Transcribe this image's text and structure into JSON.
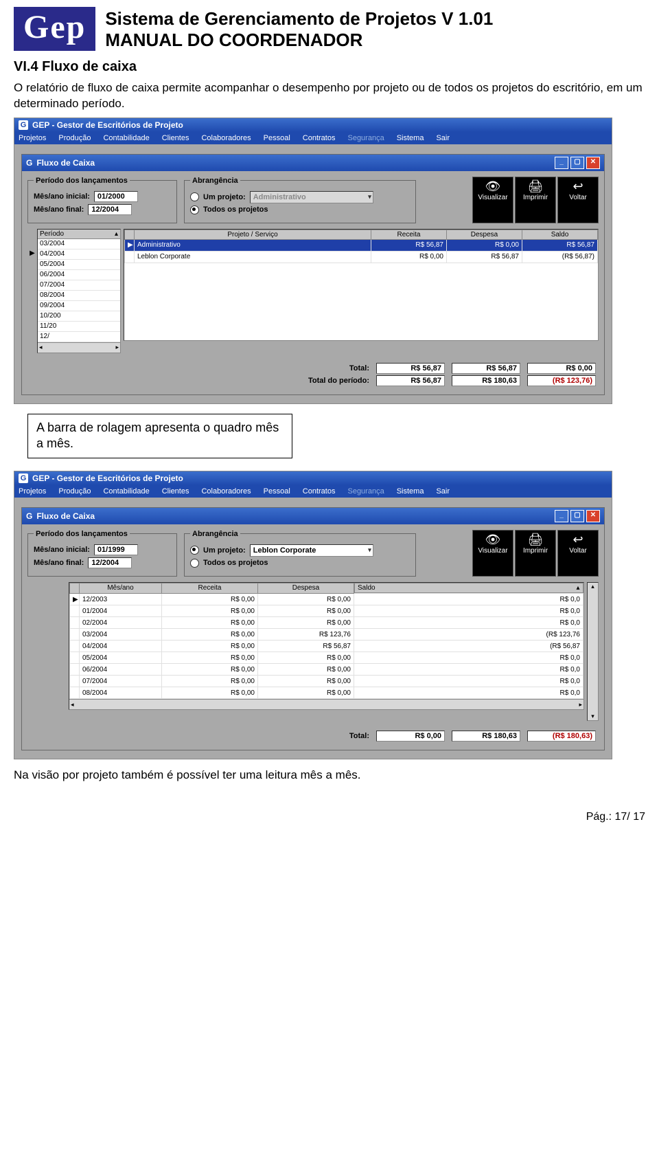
{
  "doc": {
    "logo_text": "Gep",
    "title": "Sistema de Gerenciamento de Projetos V 1.01",
    "subtitle": "MANUAL DO COORDENADOR",
    "section_heading": "VI.4  Fluxo de caixa",
    "paragraph": "O  relatório  de fluxo de caixa permite acompanhar o desempenho por projeto ou de todos os projetos do escritório, em um determinado período.",
    "callout": "A barra de rolagem apresenta o quadro mês a mês.",
    "closing_line": "Na visão por projeto também é possível ter uma leitura mês a mês.",
    "page_footer": "Pág.: 17/ 17"
  },
  "common": {
    "app_title": "GEP - Gestor de Escritórios de Projeto",
    "menus": [
      "Projetos",
      "Produção",
      "Contabilidade",
      "Clientes",
      "Colaboradores",
      "Pessoal",
      "Contratos",
      "Segurança",
      "Sistema",
      "Sair"
    ],
    "disabled_menu": "Segurança",
    "window_title": "Fluxo de Caixa",
    "grp_periodo": "Período dos lançamentos",
    "grp_abrang": "Abrangência",
    "lbl_mes_ini": "Mês/ano inicial:",
    "lbl_mes_fim": "Mês/ano final:",
    "opt_um_projeto": "Um projeto:",
    "opt_todos": "Todos os projetos",
    "btn_visualizar": "Visualizar",
    "btn_imprimir": "Imprimir",
    "btn_voltar": "Voltar",
    "lbl_total": "Total:",
    "lbl_total_periodo": "Total do período:"
  },
  "shot1": {
    "mes_ini": "01/2000",
    "mes_fim": "12/2004",
    "combo_projeto": "Administrativo",
    "radio_selected": "todos",
    "period_header": "Período",
    "period_list": [
      "03/2004",
      "04/2004",
      "05/2004",
      "06/2004",
      "07/2004",
      "08/2004",
      "09/2004",
      "10/200",
      "11/20",
      "12/"
    ],
    "period_selected": "04/2004",
    "grid_headers": [
      "Projeto / Serviço",
      "Receita",
      "Despesa",
      "Saldo"
    ],
    "grid_rows": [
      {
        "proj": "Administrativo",
        "receita": "R$ 56,87",
        "despesa": "R$ 0,00",
        "saldo": "R$ 56,87",
        "hl": true
      },
      {
        "proj": "Leblon Corporate",
        "receita": "R$ 0,00",
        "despesa": "R$ 56,87",
        "saldo": "(R$ 56,87)",
        "hl": false
      }
    ],
    "totals": {
      "receita": "R$ 56,87",
      "despesa": "R$ 56,87",
      "saldo": "R$ 0,00"
    },
    "totals_periodo": {
      "receita": "R$ 56,87",
      "despesa": "R$ 180,63",
      "saldo": "(R$ 123,76)",
      "saldo_neg": true
    }
  },
  "shot2": {
    "mes_ini": "01/1999",
    "mes_fim": "12/2004",
    "combo_projeto": "Leblon Corporate",
    "radio_selected": "um",
    "grid_headers": [
      "Mês/ano",
      "Receita",
      "Despesa",
      "Saldo"
    ],
    "grid_rows": [
      {
        "mes": "12/2003",
        "receita": "R$ 0,00",
        "despesa": "R$ 0,00",
        "saldo": "R$ 0,0"
      },
      {
        "mes": "01/2004",
        "receita": "R$ 0,00",
        "despesa": "R$ 0,00",
        "saldo": "R$ 0,0"
      },
      {
        "mes": "02/2004",
        "receita": "R$ 0,00",
        "despesa": "R$ 0,00",
        "saldo": "R$ 0,0"
      },
      {
        "mes": "03/2004",
        "receita": "R$ 0,00",
        "despesa": "R$ 123,76",
        "saldo": "(R$ 123,76"
      },
      {
        "mes": "04/2004",
        "receita": "R$ 0,00",
        "despesa": "R$ 56,87",
        "saldo": "(R$ 56,87"
      },
      {
        "mes": "05/2004",
        "receita": "R$ 0,00",
        "despesa": "R$ 0,00",
        "saldo": "R$ 0,0"
      },
      {
        "mes": "06/2004",
        "receita": "R$ 0,00",
        "despesa": "R$ 0,00",
        "saldo": "R$ 0,0"
      },
      {
        "mes": "07/2004",
        "receita": "R$ 0,00",
        "despesa": "R$ 0,00",
        "saldo": "R$ 0,0"
      },
      {
        "mes": "08/2004",
        "receita": "R$ 0,00",
        "despesa": "R$ 0,00",
        "saldo": "R$ 0,0"
      }
    ],
    "totals": {
      "receita": "R$ 0,00",
      "despesa": "R$ 180,63",
      "saldo": "(R$ 180,63)",
      "saldo_neg": true
    }
  }
}
